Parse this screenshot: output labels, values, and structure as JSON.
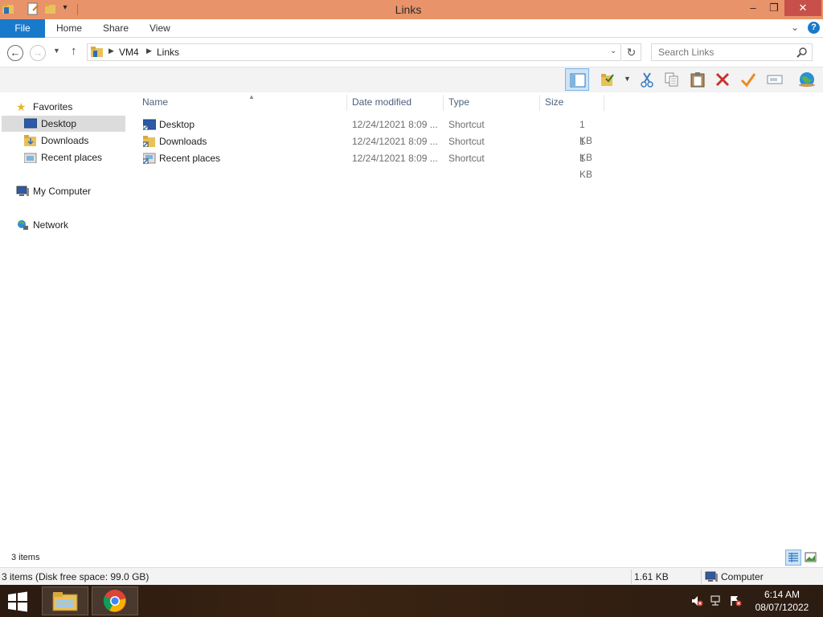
{
  "window": {
    "title": "Links",
    "minimize": "–",
    "restore": "❐",
    "close": "✕"
  },
  "ribbon": {
    "file_tab": "File",
    "tabs": [
      "Home",
      "Share",
      "View"
    ],
    "help": "?"
  },
  "address": {
    "back": "←",
    "forward": "→",
    "up": "↑",
    "crumbs": [
      "VM4",
      "Links"
    ],
    "refresh": "↻",
    "search_placeholder": "Search Links"
  },
  "toolbar": {
    "buttons": [
      "preview-pane-icon",
      "folder-options-icon",
      "cut-icon",
      "copy-icon",
      "paste-icon",
      "delete-icon",
      "checkmark-icon",
      "rename-icon",
      "globe-icon"
    ]
  },
  "navigation": {
    "favorites": "Favorites",
    "favorites_items": [
      "Desktop",
      "Downloads",
      "Recent places"
    ],
    "computer": "My Computer",
    "network": "Network"
  },
  "files": {
    "columns": [
      "Name",
      "Date modified",
      "Type",
      "Size"
    ],
    "rows": [
      {
        "name": "Desktop",
        "date": "12/24/12021 8:09 ...",
        "type": "Shortcut",
        "size": "1 KB"
      },
      {
        "name": "Downloads",
        "date": "12/24/12021 8:09 ...",
        "type": "Shortcut",
        "size": "1 KB"
      },
      {
        "name": "Recent places",
        "date": "12/24/12021 8:09 ...",
        "type": "Shortcut",
        "size": "1 KB"
      }
    ]
  },
  "status": {
    "items_count": "3 items",
    "disk_info": "3 items (Disk free space: 99.0 GB)",
    "selection_size": "1.61 KB",
    "location": "Computer"
  },
  "taskbar": {
    "time": "6:14 AM",
    "date": "08/07/12022"
  },
  "colors": {
    "titlebar": "#e8936a",
    "file_tab": "#1979ca",
    "selection": "#dcdcdc",
    "taskbar": "#2a1a10"
  }
}
